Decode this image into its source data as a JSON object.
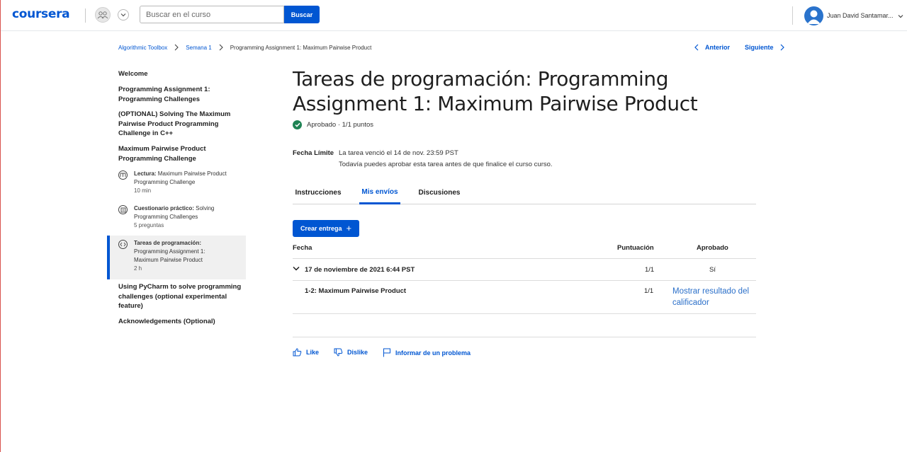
{
  "header": {
    "logo": "coursera",
    "search_placeholder": "Buscar en el curso",
    "search_button": "Buscar",
    "user_name": "Juan David Santamar..."
  },
  "breadcrumb": {
    "items": [
      "Algorithmic Toolbox",
      "Semana 1",
      "Programming Assignment 1: Maximum Pairwise Product"
    ],
    "prev": "Anterior",
    "next": "Siguiente"
  },
  "sidebar": {
    "sections": [
      {
        "label": "Welcome"
      },
      {
        "label": "Programming Assignment 1: Programming Challenges"
      },
      {
        "label": "(OPTIONAL) Solving The Maximum Pairwise Product Programming Challenge in C++"
      },
      {
        "label": "Maximum Pairwise Product Programming Challenge"
      },
      {
        "label": "Using PyCharm to solve programming challenges (optional experimental feature)"
      },
      {
        "label": "Acknowledgements (Optional)"
      }
    ],
    "items": [
      {
        "type": "Lectura:",
        "title": "Maximum Pairwise Product Programming Challenge",
        "meta": "10 min",
        "icon": "book-icon"
      },
      {
        "type": "Cuestionario práctico:",
        "title": "Solving Programming Challenges",
        "meta": "5 preguntas",
        "icon": "quiz-icon"
      },
      {
        "type": "Tareas de programación:",
        "title": "Programming Assignment 1: Maximum Pairwise Product",
        "meta": "2 h",
        "icon": "code-icon"
      }
    ]
  },
  "main": {
    "title": "Tareas de programación: Programming Assignment 1: Maximum Pairwise Product",
    "status": "Aprobado · 1/1 puntos",
    "deadline_label": "Fecha Límite",
    "deadline_value": "La tarea venció el 14 de nov. 23:59 PST",
    "deadline_note": "Todavía puedes aprobar esta tarea antes de que finalice el curso curso.",
    "tabs": [
      "Instrucciones",
      "Mis envíos",
      "Discusiones"
    ],
    "active_tab": "Mis envíos",
    "create_button": "Crear entrega",
    "table": {
      "headers": [
        "Fecha",
        "Puntuación",
        "Aprobado"
      ],
      "submission": {
        "date": "17 de noviembre de 2021 6:44 PST",
        "score": "1/1",
        "passed": "Sí"
      },
      "part": {
        "name": "1-2: Maximum Pairwise Product",
        "score": "1/1",
        "link": "Mostrar resultado del calificador"
      }
    },
    "feedback": {
      "like": "Like",
      "dislike": "Dislike",
      "report": "Informar de un problema"
    }
  },
  "colors": {
    "accent": "#0056d2",
    "success": "#1f8354",
    "link": "#2a6fc9"
  }
}
